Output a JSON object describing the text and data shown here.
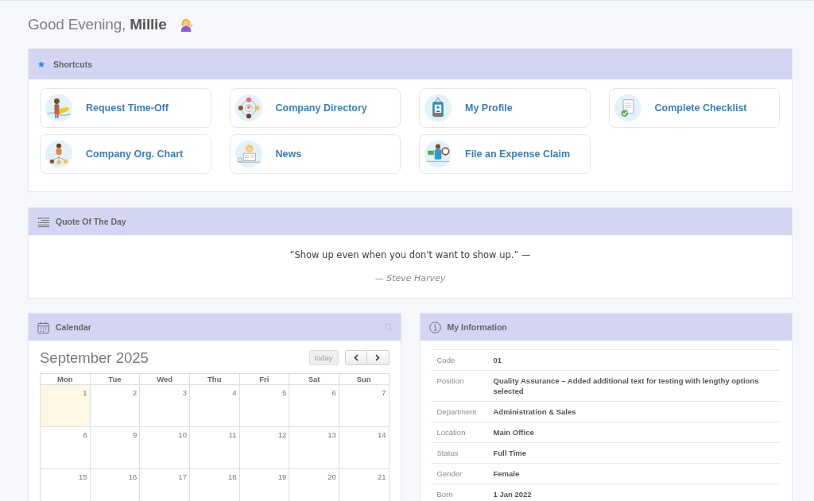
{
  "greeting": {
    "text": "Good Evening, **Millie**"
  },
  "shortcuts": {
    "title": "Shortcuts",
    "items": [
      {
        "label": "Request Time-Off"
      },
      {
        "label": "Company Directory"
      },
      {
        "label": "My Profile"
      },
      {
        "label": "Complete Checklist"
      },
      {
        "label": "Company Org. Chart"
      },
      {
        "label": "News"
      },
      {
        "label": "File an Expense Claim"
      }
    ]
  },
  "quote_of_the_day": {
    "title": "Quote Of The Day",
    "quote": "“Show up even when you don't want to show up.” —",
    "author": "— Steve Harvey"
  },
  "calendar": {
    "title": "Calendar",
    "month": "September 2025",
    "today_button": {
      "label": "today",
      "disabled": true
    },
    "weekdays": [
      "Mon",
      "Tue",
      "Wed",
      "Thu",
      "Fri",
      "Sat",
      "Sun"
    ],
    "weeks": [
      [
        {
          "day": "1",
          "today": true
        },
        {
          "day": "2",
          "today": false
        },
        {
          "day": "3",
          "today": false
        },
        {
          "day": "4",
          "today": false
        },
        {
          "day": "5",
          "today": false
        },
        {
          "day": "6",
          "today": false
        },
        {
          "day": "7",
          "today": false
        }
      ],
      [
        {
          "day": "8",
          "today": false
        },
        {
          "day": "9",
          "today": false
        },
        {
          "day": "10",
          "today": false
        },
        {
          "day": "11",
          "today": false
        },
        {
          "day": "12",
          "today": false
        },
        {
          "day": "13",
          "today": false
        },
        {
          "day": "14",
          "today": false
        }
      ],
      [
        {
          "day": "15",
          "today": false
        },
        {
          "day": "16",
          "today": false
        },
        {
          "day": "17",
          "today": false
        },
        {
          "day": "18",
          "today": false
        },
        {
          "day": "19",
          "today": false
        },
        {
          "day": "20",
          "today": false
        },
        {
          "day": "21",
          "today": false
        }
      ]
    ]
  },
  "my_information": {
    "title": "My Information",
    "rows": [
      {
        "label": "Code",
        "value": "01"
      },
      {
        "label": "Position",
        "value": "Quality Assurance – Added additional text for testing with lengthy options selected"
      },
      {
        "label": "Department",
        "value": "Administration & Sales"
      },
      {
        "label": "Location",
        "value": "Main Office"
      },
      {
        "label": "Status",
        "value": "Full Time"
      },
      {
        "label": "Gender",
        "value": "Female"
      },
      {
        "label": "Born",
        "value": "1 Jan 2022"
      }
    ]
  }
}
